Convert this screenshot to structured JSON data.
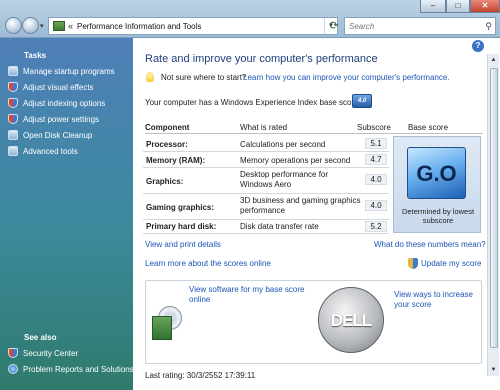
{
  "addressbar": {
    "path": "Performance Information and Tools",
    "search_placeholder": "Search"
  },
  "sidebar": {
    "tasks_heading": "Tasks",
    "tasks": [
      {
        "label": "Manage startup programs",
        "icon": "startup-icon"
      },
      {
        "label": "Adjust visual effects",
        "icon": "shield-icon"
      },
      {
        "label": "Adjust indexing options",
        "icon": "indexing-icon"
      },
      {
        "label": "Adjust power settings",
        "icon": "power-icon"
      },
      {
        "label": "Open Disk Cleanup",
        "icon": "disk-cleanup-icon"
      },
      {
        "label": "Advanced tools",
        "icon": "tools-icon"
      }
    ],
    "see_also_heading": "See also",
    "see_also": [
      {
        "label": "Security Center",
        "icon": "shield-icon"
      },
      {
        "label": "Problem Reports and Solutions",
        "icon": "globe-icon"
      }
    ]
  },
  "main": {
    "title": "Rate and improve your computer's performance",
    "tip_question": "Not sure where to start?",
    "tip_link": "Learn how you can improve your computer's performance.",
    "base_score_text": "Your computer has a Windows Experience Index base score of",
    "table": {
      "headers": {
        "component": "Component",
        "what": "What is rated",
        "subscore": "Subscore",
        "base": "Base score"
      },
      "rows": [
        {
          "component": "Processor:",
          "what": "Calculations per second",
          "subscore": "5.1"
        },
        {
          "component": "Memory (RAM):",
          "what": "Memory operations per second",
          "subscore": "4.7"
        },
        {
          "component": "Graphics:",
          "what": "Desktop performance for Windows Aero",
          "subscore": "4.0"
        },
        {
          "component": "Gaming graphics:",
          "what": "3D business and gaming graphics performance",
          "subscore": "4.0"
        },
        {
          "component": "Primary hard disk:",
          "what": "Disk data transfer rate",
          "subscore": "5.2"
        }
      ],
      "base_caption": "Determined by lowest subscore",
      "base_logo": "G.O"
    },
    "links": {
      "view_print": "View and print details",
      "what_mean": "What do these numbers mean?",
      "learn_more": "Learn more about the scores online",
      "update": "Update my score"
    },
    "offers": {
      "software": "View software for my base score online",
      "increase": "View ways to increase your score",
      "brand": "DELL"
    },
    "last_rating": "Last rating: 30/3/2552 17:39:11"
  }
}
